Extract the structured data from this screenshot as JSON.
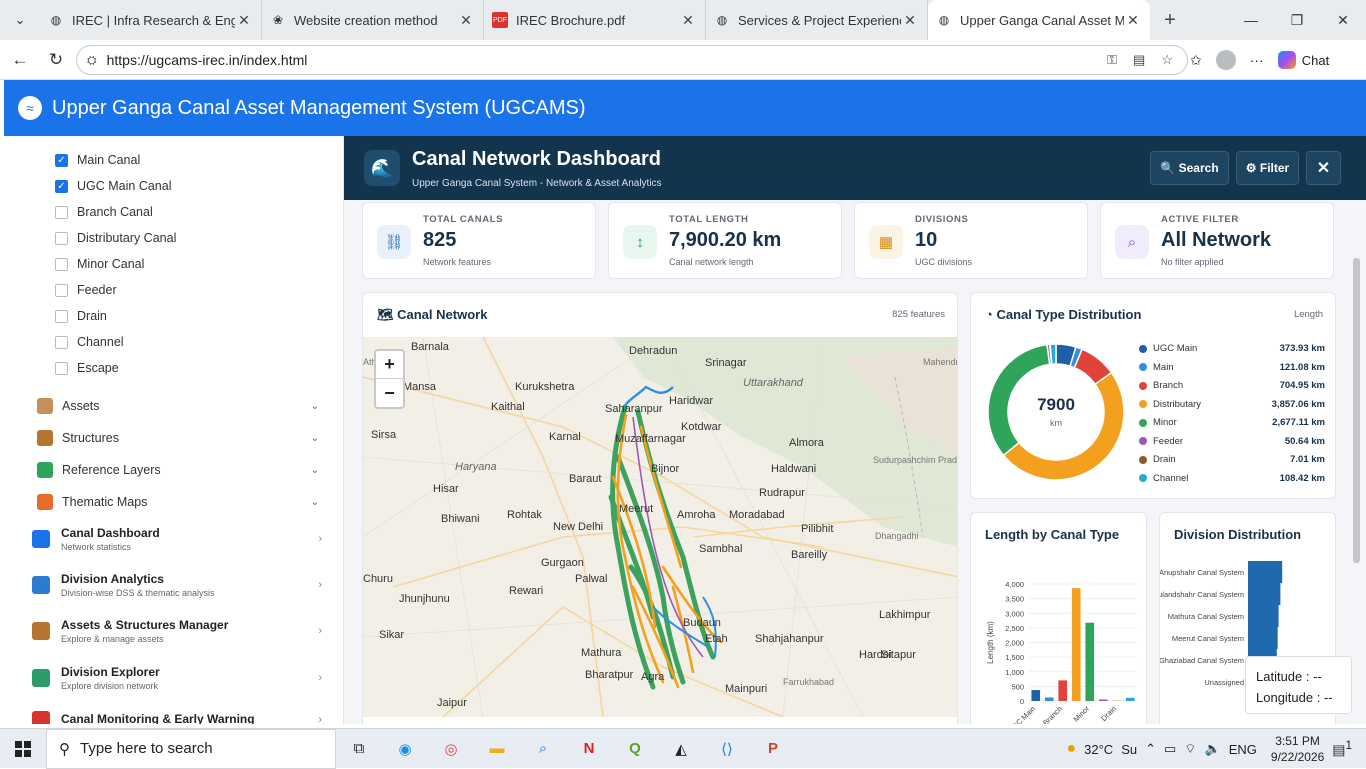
{
  "browser": {
    "tabs": [
      {
        "title": "IREC | Infra Research & Engineering",
        "icon": "globe-icon"
      },
      {
        "title": "Website creation method",
        "icon": "openai-icon"
      },
      {
        "title": "IREC Brochure.pdf",
        "icon": "pdf-icon"
      },
      {
        "title": "Services & Project Experience |",
        "icon": "globe-icon"
      },
      {
        "title": "Upper Ganga Canal Asset Man",
        "icon": "globe-icon"
      }
    ],
    "url": "https://ugcams-irec.in/index.html",
    "chat_label": "Chat"
  },
  "app": {
    "title": "Upper Ganga Canal Asset Management System (UGCAMS)"
  },
  "sidebar": {
    "layers": [
      {
        "label": "Main Canal",
        "checked": true
      },
      {
        "label": "UGC Main Canal",
        "checked": true
      },
      {
        "label": "Branch Canal",
        "checked": false
      },
      {
        "label": "Distributary Canal",
        "checked": false
      },
      {
        "label": "Minor Canal",
        "checked": false
      },
      {
        "label": "Feeder",
        "checked": false
      },
      {
        "label": "Drain",
        "checked": false
      },
      {
        "label": "Channel",
        "checked": false
      },
      {
        "label": "Escape",
        "checked": false
      }
    ],
    "sections": [
      {
        "label": "Assets",
        "icon": "assets-icon"
      },
      {
        "label": "Structures",
        "icon": "structures-icon"
      },
      {
        "label": "Reference Layers",
        "icon": "globe-icon"
      },
      {
        "label": "Thematic Maps",
        "icon": "rainbow-icon"
      }
    ],
    "modules": [
      {
        "title": "Canal Dashboard",
        "subtitle": "Network statistics",
        "icon": "wave-icon"
      },
      {
        "title": "Division Analytics",
        "subtitle": "Division-wise DSS & thematic analysis",
        "icon": "grid-icon"
      },
      {
        "title": "Assets & Structures Manager",
        "subtitle": "Explore & manage assets",
        "icon": "structures-icon"
      },
      {
        "title": "Division Explorer",
        "subtitle": "Explore division network",
        "icon": "map-icon"
      },
      {
        "title": "Canal Monitoring & Early Warning",
        "subtitle": "",
        "icon": "alert-icon"
      }
    ]
  },
  "dashboard": {
    "title": "Canal Network Dashboard",
    "subtitle": "Upper Ganga Canal System - Network & Asset Analytics",
    "search_label": "🔍 Search",
    "filter_label": "⚙ Filter",
    "close_label": "✕",
    "stats": [
      {
        "label": "TOTAL CANALS",
        "value": "825",
        "sub": "Network features",
        "icon": "link-icon",
        "color": "#e8f1fb"
      },
      {
        "label": "TOTAL LENGTH",
        "value": "7,900.20 km",
        "sub": "Canal network length",
        "icon": "arrows-icon",
        "color": "#e7f6ef"
      },
      {
        "label": "DIVISIONS",
        "value": "10",
        "sub": "UGC divisions",
        "icon": "grid-icon",
        "color": "#fdf3e4"
      },
      {
        "label": "ACTIVE FILTER",
        "value": "All Network",
        "sub": "No filter applied",
        "icon": "search-icon",
        "color": "#f1ecfb"
      }
    ],
    "map_card": {
      "title": "🗺 Canal Network",
      "meta": "825 features"
    },
    "places": [
      "Barnala",
      "Dehradun",
      "Srinagar",
      "Mansa",
      "Kurukshetra",
      "Haridwar",
      "Uttarakhand",
      "Kaithal",
      "Saharanpur",
      "Sirsa",
      "Karnal",
      "Muzaffarnagar",
      "Kotdwar",
      "Almora",
      "Haryana",
      "Bijnor",
      "Haldwani",
      "Hisar",
      "Baraut",
      "Rudrapur",
      "Bhiwani",
      "Rohtak",
      "Meerut",
      "Amroha",
      "Moradabad",
      "Pilibhit",
      "New Delhi",
      "Gurgaon",
      "Sambhal",
      "Bareilly",
      "Churu",
      "Rewari",
      "Palwal",
      "Jhunjhunu",
      "Sikar",
      "Lakhimpur",
      "Mathura",
      "Hardoi",
      "Sitapur",
      "Bharatpur",
      "Agra",
      "Mainpuri",
      "Jaipur",
      "Etah",
      "Budaun",
      "Shahjahanpur",
      "Ath",
      "Dhangadhi",
      "Mahendranagar",
      "Sudurpashchim Pradesh",
      "Farrukhabad"
    ],
    "donut": {
      "title": "Canal Type Distribution",
      "meta": "Length",
      "center_value": "7900",
      "center_unit": "km"
    },
    "bar_card": {
      "title": "Length by Canal Type"
    },
    "division_card": {
      "title": "Division Distribution",
      "labels": [
        "Anupshahr Canal System",
        "Bulandshahr Canal System",
        "Mathura Canal System",
        "Meerut Canal System",
        "Ghaziabad Canal System",
        "Unassigned"
      ],
      "values": [
        38,
        36,
        34,
        33,
        32,
        0
      ]
    }
  },
  "chart_data": [
    {
      "type": "pie",
      "title": "Canal Type Distribution",
      "categories": [
        "UGC Main",
        "Main",
        "Branch",
        "Distributary",
        "Minor",
        "Feeder",
        "Drain",
        "Channel"
      ],
      "values": [
        373.93,
        121.08,
        704.95,
        3857.06,
        2677.11,
        50.64,
        7.01,
        108.42
      ],
      "labels": [
        "373.93 km",
        "121.08 km",
        "704.95 km",
        "3,857.06 km",
        "2,677.11 km",
        "50.64 km",
        "7.01 km",
        "108.42 km"
      ],
      "colors": [
        "#1f5fa8",
        "#2e8fe0",
        "#e0433a",
        "#f3a01f",
        "#2ea55a",
        "#9b59b6",
        "#8b5a2b",
        "#26a9d6"
      ]
    },
    {
      "type": "bar",
      "title": "Length by Canal Type",
      "categories": [
        "UGC Main",
        "Main",
        "Branch",
        "Distributary",
        "Minor",
        "Feeder",
        "Drain",
        "Channel"
      ],
      "tick_labels": [
        "UGC Main",
        "",
        "Branch",
        "",
        "Minor",
        "",
        "Drain",
        ""
      ],
      "values": [
        373.93,
        121.08,
        704.95,
        3857.06,
        2677.11,
        50.64,
        7.01,
        108.42
      ],
      "ylabel": "Length (km)",
      "ylim": [
        0,
        4000
      ],
      "yticks": [
        "0",
        "500",
        "1,000",
        "1,500",
        "2,000",
        "2,500",
        "3,000",
        "3,500",
        "4,000"
      ]
    }
  ],
  "coords": {
    "lat": "Latitude : --",
    "lon": "Longitude : --"
  },
  "taskbar": {
    "search": "Type here to search",
    "temp": "32°C",
    "weather": "Su",
    "lang": "ENG",
    "time": "3:51 PM",
    "date": "9/22/2026",
    "notif": "1"
  }
}
